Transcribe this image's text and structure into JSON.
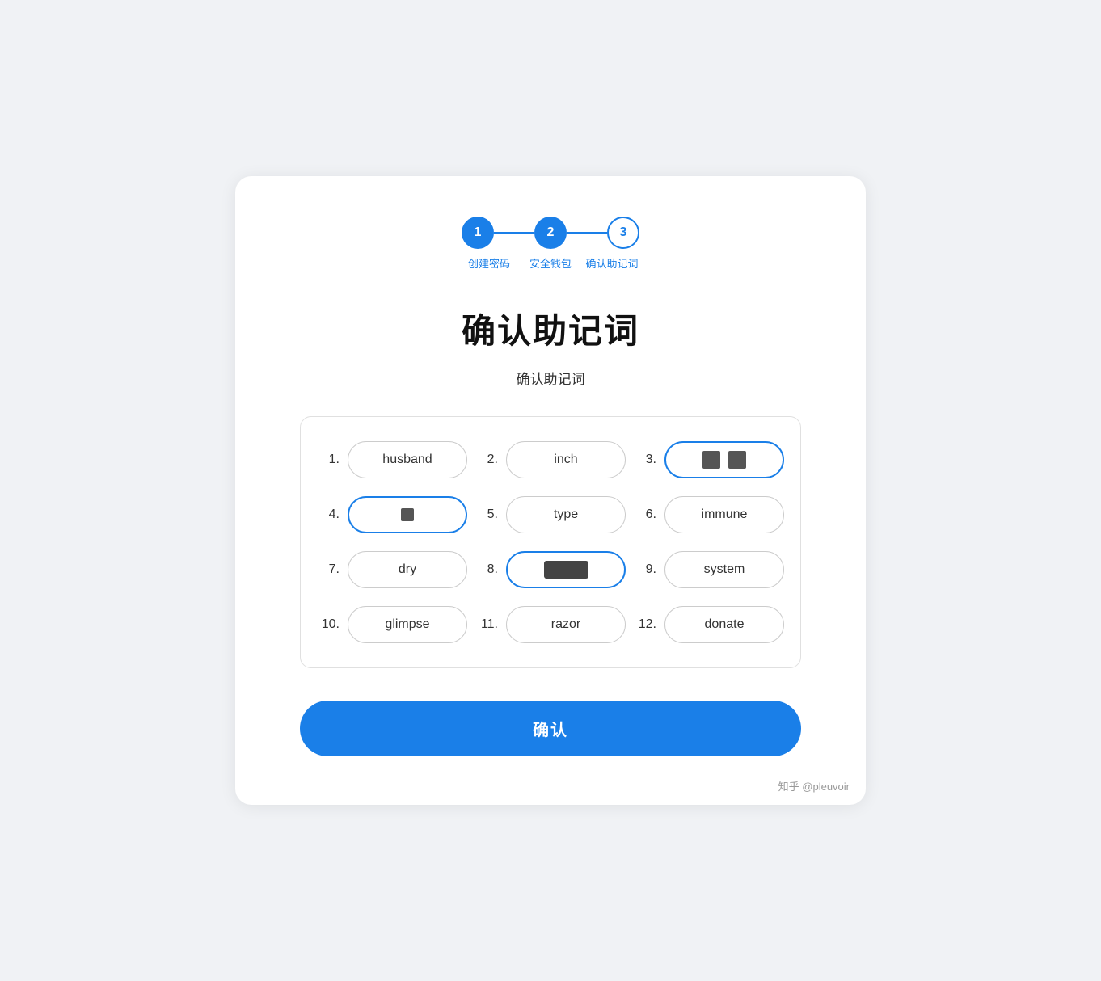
{
  "stepper": {
    "steps": [
      {
        "number": "1",
        "label": "创建密码",
        "state": "active"
      },
      {
        "number": "2",
        "label": "安全钱包",
        "state": "active"
      },
      {
        "number": "3",
        "label": "确认助记词",
        "state": "outline"
      }
    ]
  },
  "title": "确认助记词",
  "subtitle": "确认助记词",
  "words": [
    {
      "index": "1.",
      "value": "husband",
      "state": "normal"
    },
    {
      "index": "2.",
      "value": "inch",
      "state": "normal"
    },
    {
      "index": "3.",
      "value": "",
      "state": "blue-redacted"
    },
    {
      "index": "4.",
      "value": "",
      "state": "blue-cursor"
    },
    {
      "index": "5.",
      "value": "type",
      "state": "normal"
    },
    {
      "index": "6.",
      "value": "immune",
      "state": "normal"
    },
    {
      "index": "7.",
      "value": "dry",
      "state": "normal"
    },
    {
      "index": "8.",
      "value": "",
      "state": "blue-wide-redacted"
    },
    {
      "index": "9.",
      "value": "system",
      "state": "normal"
    },
    {
      "index": "10.",
      "value": "glimpse",
      "state": "normal"
    },
    {
      "index": "11.",
      "value": "razor",
      "state": "normal"
    },
    {
      "index": "12.",
      "value": "donate",
      "state": "normal"
    }
  ],
  "confirm_button": "确认",
  "watermark": "知乎 @pleuvoir"
}
